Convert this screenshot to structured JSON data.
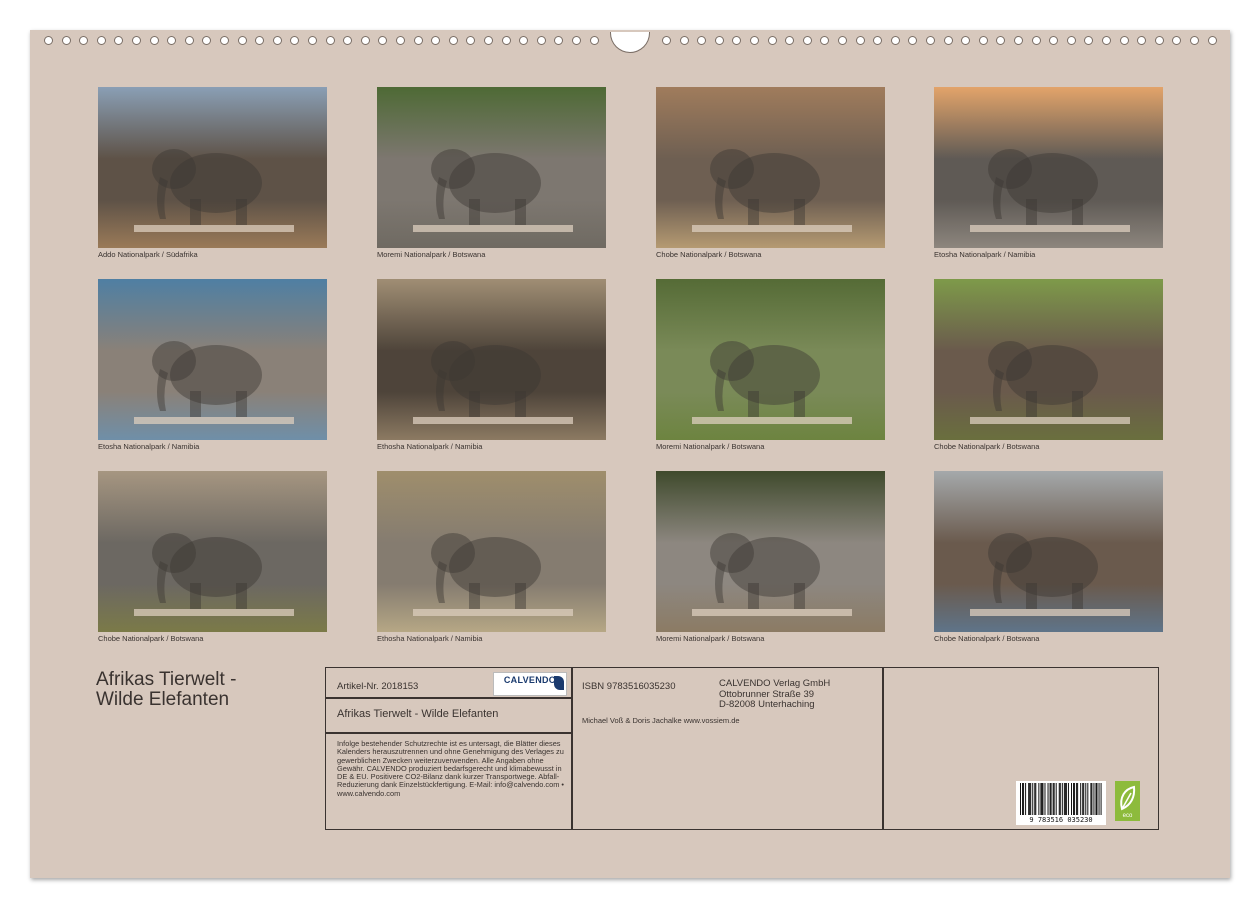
{
  "calendar": {
    "title_line1": "Afrikas Tierwelt -",
    "title_line2": "Wilde Elefanten",
    "photos": [
      {
        "caption": "Addo Nationalpark / Südafrika",
        "sky": "#8a9fb5",
        "ground": "#9a7a58",
        "tone": "#5e5247"
      },
      {
        "caption": "Moremi Nationalpark / Botswana",
        "sky": "#4e6a35",
        "ground": "#6f6a62",
        "tone": "#7d7770"
      },
      {
        "caption": "Chobe Nationalpark / Botswana",
        "sky": "#a07c5c",
        "ground": "#b59a72",
        "tone": "#6e5f52"
      },
      {
        "caption": "Etosha Nationalpark / Namibia",
        "sky": "#e3a46a",
        "ground": "#8d867e",
        "tone": "#5f5a55"
      },
      {
        "caption": "Etosha Nationalpark / Namibia",
        "sky": "#4f7fa3",
        "ground": "#6f8fa8",
        "tone": "#8a8178"
      },
      {
        "caption": "Ethosha Nationalpark / Namibia",
        "sky": "#a08e74",
        "ground": "#8c7a62",
        "tone": "#4e443a"
      },
      {
        "caption": "Moremi Nationalpark / Botswana",
        "sky": "#556b36",
        "ground": "#6d8440",
        "tone": "#7a8a58"
      },
      {
        "caption": "Chobe Nationalpark / Botswana",
        "sky": "#7e9a4a",
        "ground": "#6a6f3e",
        "tone": "#6a5a4c"
      },
      {
        "caption": "Chobe Nationalpark / Botswana",
        "sky": "#a69681",
        "ground": "#7b7a48",
        "tone": "#6c6862"
      },
      {
        "caption": "Ethosha Nationalpark / Namibia",
        "sky": "#9f8e6c",
        "ground": "#b6a785",
        "tone": "#857c70"
      },
      {
        "caption": "Moremi Nationalpark / Botswana",
        "sky": "#3f4a2c",
        "ground": "#8c7b64",
        "tone": "#8d8780"
      },
      {
        "caption": "Chobe Nationalpark / Botswana",
        "sky": "#a5a9ab",
        "ground": "#5f7489",
        "tone": "#6a5a4d"
      }
    ]
  },
  "info": {
    "article": "Artikel-Nr. 2018153",
    "product_title": "Afrikas Tierwelt - Wilde Elefanten",
    "legal": "Infolge bestehender Schutzrechte ist es untersagt, die Blätter dieses Kalenders herauszutrennen und ohne Genehmigung des Verlages zu gewerblichen Zwecken weiterzuverwenden. Alle Angaben ohne Gewähr. CALVENDO produziert bedarfsgerecht und klimabewusst in DE & EU. Positivere CO2-Bilanz dank kurzer Transportwege. Abfall-Reduzierung dank Einzelstückfertigung. E-Mail: info@calvendo.com • www.calvendo.com",
    "isbn": "ISBN 9783516035230",
    "publisher_name": "CALVENDO Verlag GmbH",
    "publisher_street": "Ottobrunner Straße 39",
    "publisher_city": "D-82008 Unterhaching",
    "authors": "Michael Voß & Doris Jachalke www.vossiem.de",
    "logo_text": "CALVENDO",
    "barcode_digits": "9 783516 035230",
    "eco_label": "eco"
  }
}
